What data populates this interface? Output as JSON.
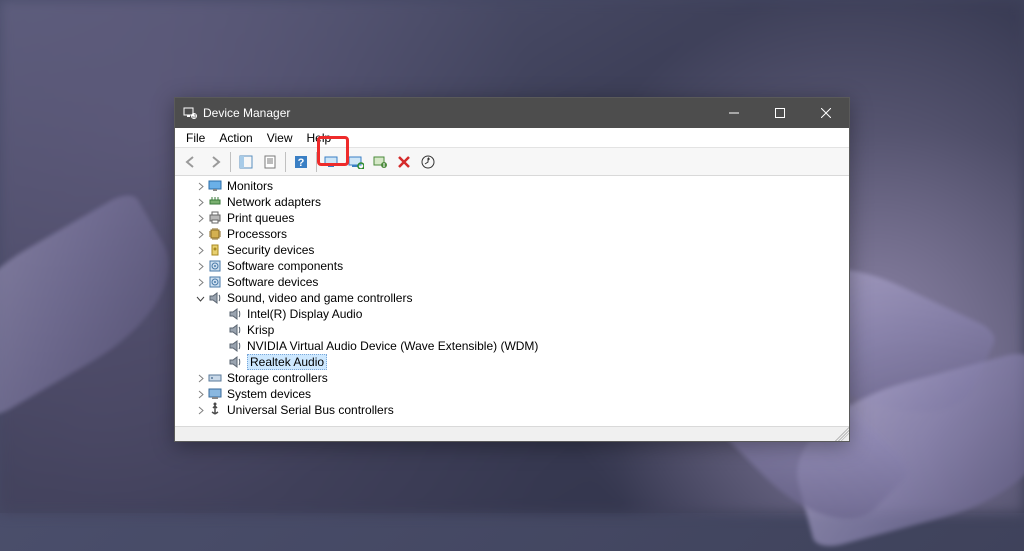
{
  "title": "Device Manager",
  "menu": {
    "file": "File",
    "action": "Action",
    "view": "View",
    "help": "Help"
  },
  "toolbar_icons": [
    "back",
    "forward",
    "show-hide-tree",
    "properties-pane",
    "help",
    "update-driver",
    "scan-hardware",
    "uninstall",
    "disable",
    "remove",
    "scan-changes"
  ],
  "tree": [
    {
      "label": "Monitors",
      "icon": "monitor",
      "level": 1,
      "expanded": false
    },
    {
      "label": "Network adapters",
      "icon": "network",
      "level": 1,
      "expanded": false
    },
    {
      "label": "Print queues",
      "icon": "printer",
      "level": 1,
      "expanded": false
    },
    {
      "label": "Processors",
      "icon": "cpu",
      "level": 1,
      "expanded": false
    },
    {
      "label": "Security devices",
      "icon": "security",
      "level": 1,
      "expanded": false
    },
    {
      "label": "Software components",
      "icon": "software",
      "level": 1,
      "expanded": false
    },
    {
      "label": "Software devices",
      "icon": "software",
      "level": 1,
      "expanded": false
    },
    {
      "label": "Sound, video and game controllers",
      "icon": "sound",
      "level": 1,
      "expanded": true
    },
    {
      "label": "Intel(R) Display Audio",
      "icon": "sound",
      "level": 2
    },
    {
      "label": "Krisp",
      "icon": "sound",
      "level": 2
    },
    {
      "label": "NVIDIA Virtual Audio Device (Wave Extensible) (WDM)",
      "icon": "sound",
      "level": 2
    },
    {
      "label": "Realtek Audio",
      "icon": "sound",
      "level": 2,
      "selected": true
    },
    {
      "label": "Storage controllers",
      "icon": "storage",
      "level": 1,
      "expanded": false
    },
    {
      "label": "System devices",
      "icon": "system",
      "level": 1,
      "expanded": false
    },
    {
      "label": "Universal Serial Bus controllers",
      "icon": "usb",
      "level": 1,
      "expanded": false
    }
  ]
}
